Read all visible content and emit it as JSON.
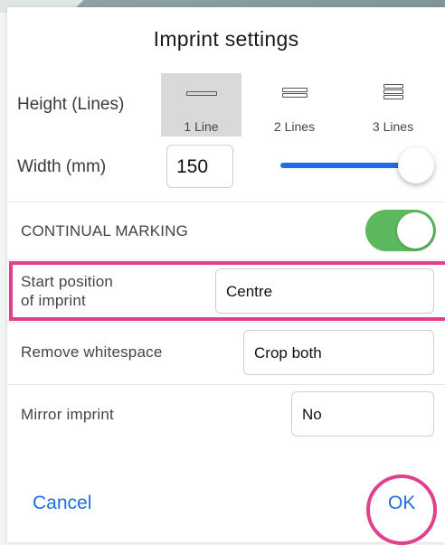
{
  "dialog": {
    "title": "Imprint settings"
  },
  "height": {
    "label": "Height (Lines)",
    "options": [
      {
        "label": "1 Line",
        "icon": "one-line-icon",
        "selected": true
      },
      {
        "label": "2 Lines",
        "icon": "two-lines-icon",
        "selected": false
      },
      {
        "label": "3 Lines",
        "icon": "three-lines-icon",
        "selected": false
      }
    ]
  },
  "width": {
    "label": "Width (mm)",
    "value": "150",
    "slider_fraction": 1.0
  },
  "continual_marking": {
    "label": "CONTINUAL MARKING",
    "enabled": true
  },
  "start_position": {
    "label_line1": "Start position",
    "label_line2": "of imprint",
    "value": "Centre"
  },
  "remove_whitespace": {
    "label": "Remove whitespace",
    "value": "Crop both"
  },
  "mirror": {
    "label": "Mirror imprint",
    "value": "No"
  },
  "actions": {
    "cancel": "Cancel",
    "ok": "OK"
  },
  "colors": {
    "accent_blue": "#1e6ee6",
    "toggle_green": "#5cb85c",
    "highlight_pink": "#e0418e",
    "selected_gray": "#d9d9d9"
  }
}
